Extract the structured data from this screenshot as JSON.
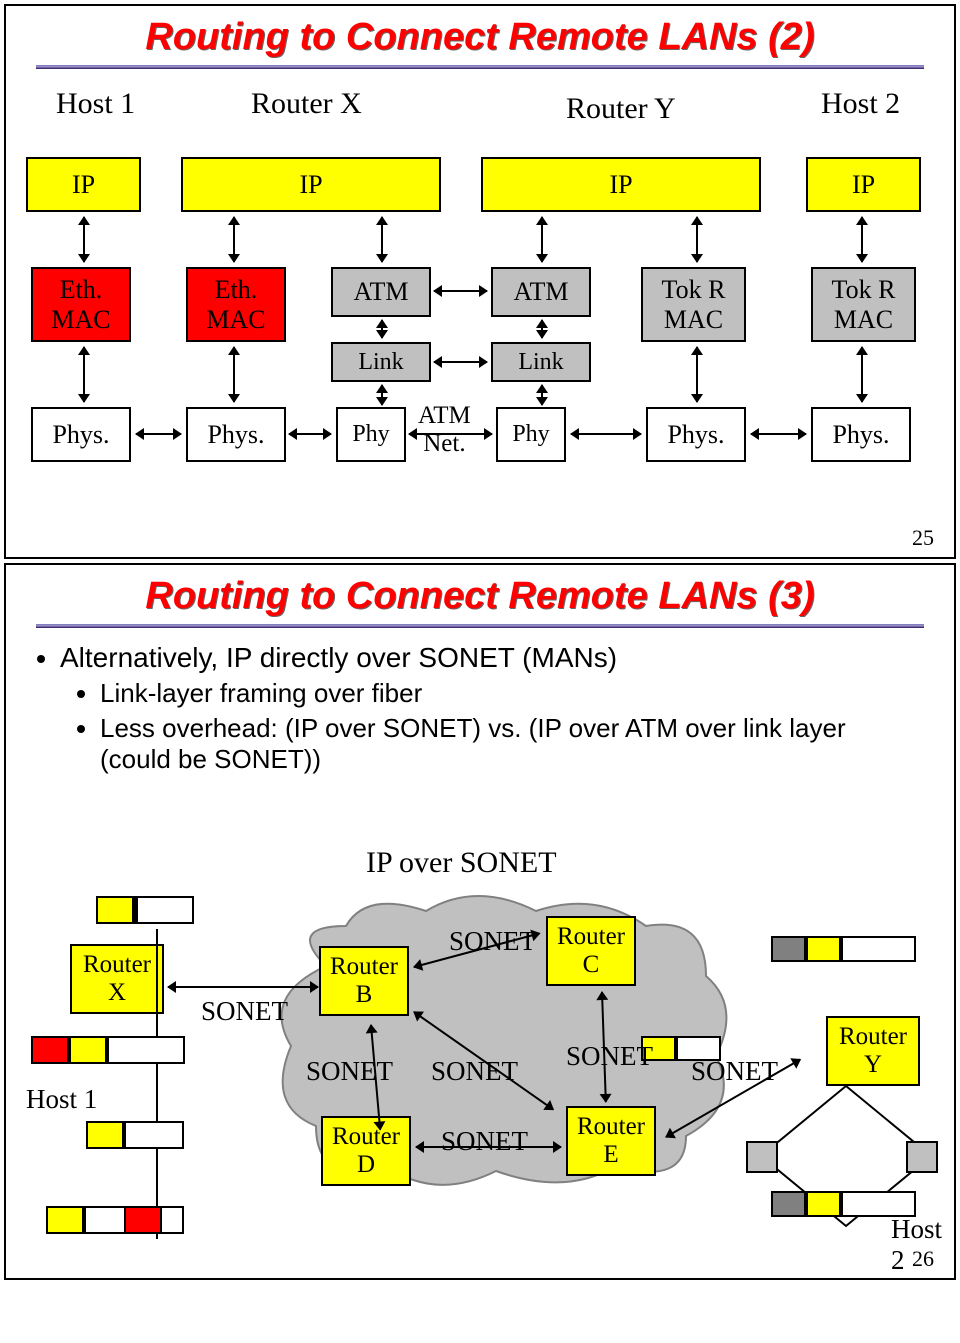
{
  "slide1": {
    "title": "Routing to Connect Remote LANs (2)",
    "labels": {
      "host1": "Host 1",
      "routerX": "Router X",
      "routerY": "Router Y",
      "host2": "Host 2"
    },
    "ip": "IP",
    "ethMac": "Eth.\nMAC",
    "atm": "ATM",
    "tokRMac": "Tok R\nMAC",
    "link": "Link",
    "phys": "Phys.",
    "phy": "Phy",
    "atmNet": "ATM\nNet.",
    "pageNum": "25"
  },
  "slide2": {
    "title": "Routing to Connect Remote LANs (3)",
    "bullet1": "Alternatively, IP directly over SONET (MANs)",
    "bullet1a": "Link-layer framing over fiber",
    "bullet1b": "Less overhead: (IP over SONET) vs. (IP over ATM over link layer (could be SONET))",
    "heading": "IP over SONET",
    "routerX": "Router\nX",
    "routerB": "Router\nB",
    "routerC": "Router\nC",
    "routerD": "Router\nD",
    "routerE": "Router\nE",
    "routerY": "Router\nY",
    "host1": "Host 1",
    "host2": "Host\n2",
    "sonet": "SONET",
    "pageNum": "26"
  }
}
